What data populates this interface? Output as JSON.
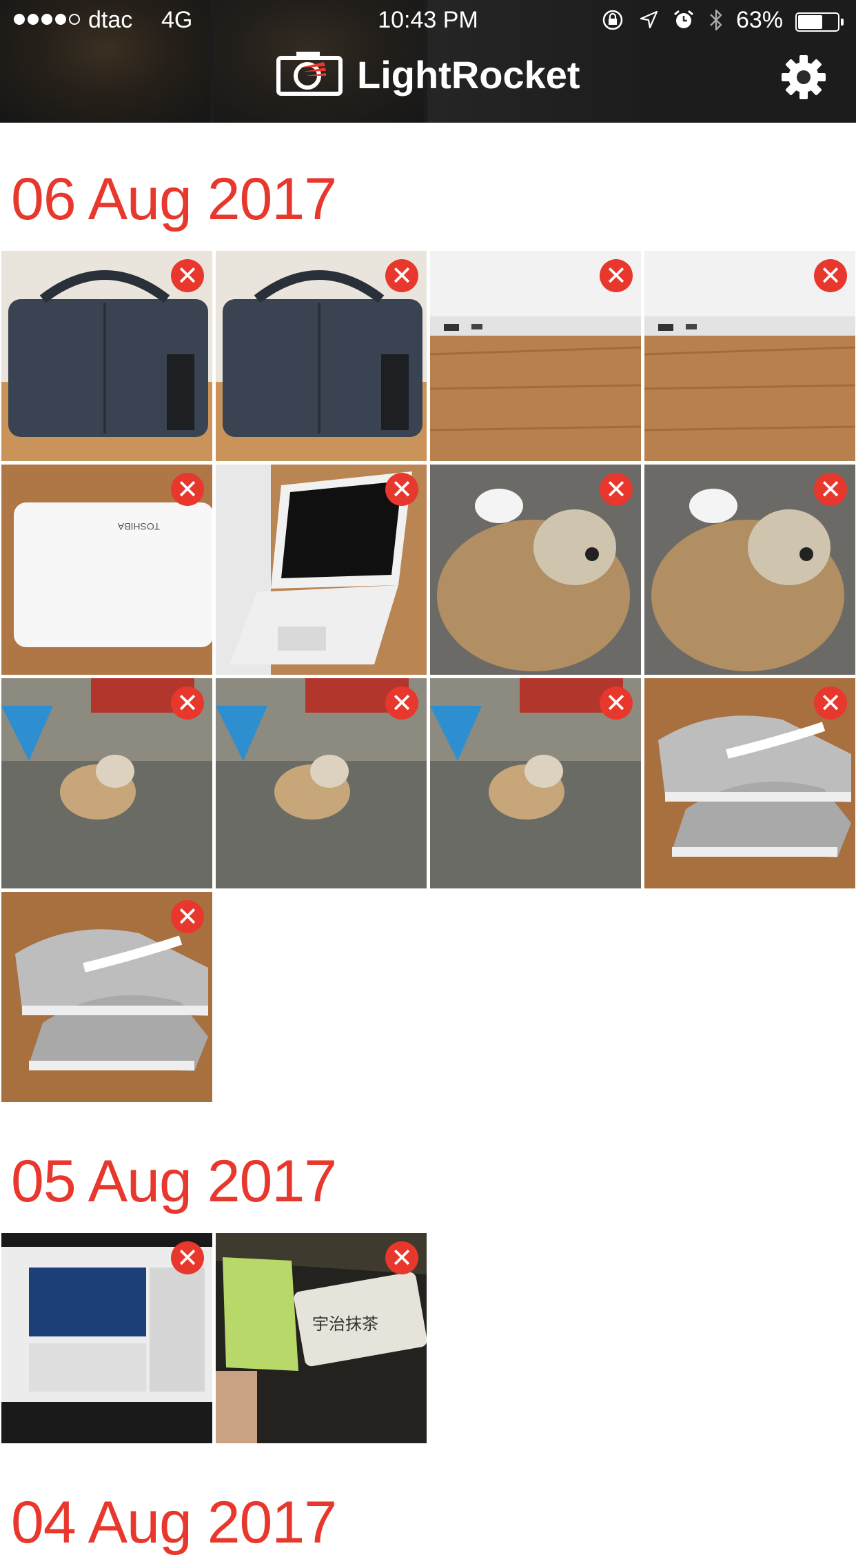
{
  "status_bar": {
    "carrier": "dtac",
    "network": "4G",
    "time": "10:43 PM",
    "battery_percent": "63%",
    "battery_level": 0.63,
    "signal_bars": 4,
    "icons": [
      "orientation-lock-icon",
      "location-icon",
      "alarm-icon",
      "bluetooth-icon"
    ]
  },
  "header": {
    "brand": "LightRocket",
    "logo_icon": "camera-logo-icon",
    "settings_icon": "gear-icon"
  },
  "colors": {
    "accent": "#e8372c",
    "header_bg": "#2b2b2b"
  },
  "sections": [
    {
      "date": "06 Aug 2017",
      "photos": [
        {
          "subject": "grey laptop bag",
          "theme": "bag"
        },
        {
          "subject": "grey laptop bag",
          "theme": "bag"
        },
        {
          "subject": "white laptop side ports",
          "theme": "laptop-side"
        },
        {
          "subject": "white laptop side ports",
          "theme": "laptop-side"
        },
        {
          "subject": "white Toshiba laptop lid",
          "theme": "laptop-lid"
        },
        {
          "subject": "open white laptop",
          "theme": "laptop-open"
        },
        {
          "subject": "small dog",
          "theme": "dog"
        },
        {
          "subject": "small dog",
          "theme": "dog"
        },
        {
          "subject": "dog on concrete floor",
          "theme": "dog-floor"
        },
        {
          "subject": "dog on concrete floor",
          "theme": "dog-floor"
        },
        {
          "subject": "dog on concrete floor",
          "theme": "dog-floor"
        },
        {
          "subject": "grey Nike sneakers",
          "theme": "shoe"
        },
        {
          "subject": "grey Nike sneakers",
          "theme": "shoe"
        }
      ]
    },
    {
      "date": "05 Aug 2017",
      "photos": [
        {
          "subject": "computer monitor with video page",
          "theme": "monitor"
        },
        {
          "subject": "green matcha ice bar",
          "theme": "icebar"
        }
      ]
    },
    {
      "date": "04 Aug 2017",
      "photos": []
    }
  ],
  "delete_icon": "close-icon"
}
